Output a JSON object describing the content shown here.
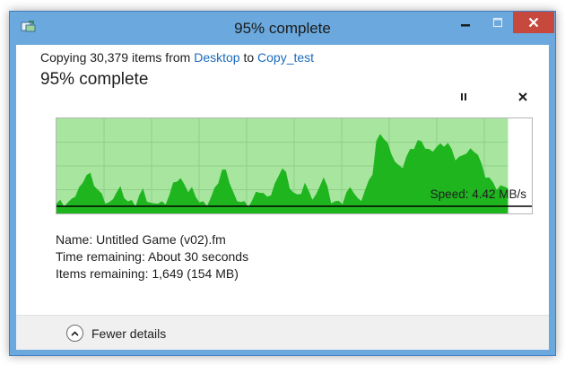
{
  "window": {
    "title": "95% complete",
    "controls": {
      "minimize_icon": "minimize-icon",
      "maximize_icon": "maximize-icon",
      "close_icon": "close-icon"
    }
  },
  "copy": {
    "prefix": "Copying 30,379 items from ",
    "source": "Desktop",
    "to": " to ",
    "destination": "Copy_test",
    "percent_text": "95% complete",
    "progress_fraction": 0.95
  },
  "actions": {
    "pause_icon": "pause-icon",
    "cancel_icon": "cancel-icon"
  },
  "graph": {
    "speed_label": "Speed: 4.42 MB/s",
    "colors": {
      "background_fill": "#a8e6a0",
      "speed_fill": "#1fb51f",
      "grid": "#8fd088",
      "baseline": "#000000"
    }
  },
  "details": {
    "name_label": "Name:",
    "name_value": "Untitled Game (v02).fm",
    "time_label": "Time remaining:",
    "time_value": "About 30 seconds",
    "items_label": "Items remaining:",
    "items_value": "1,649 (154 MB)"
  },
  "footer": {
    "fewer_details": "Fewer details"
  },
  "colors": {
    "title_bar": "#6aa8dd",
    "close_button": "#c7483d",
    "link": "#1a6bbd"
  }
}
